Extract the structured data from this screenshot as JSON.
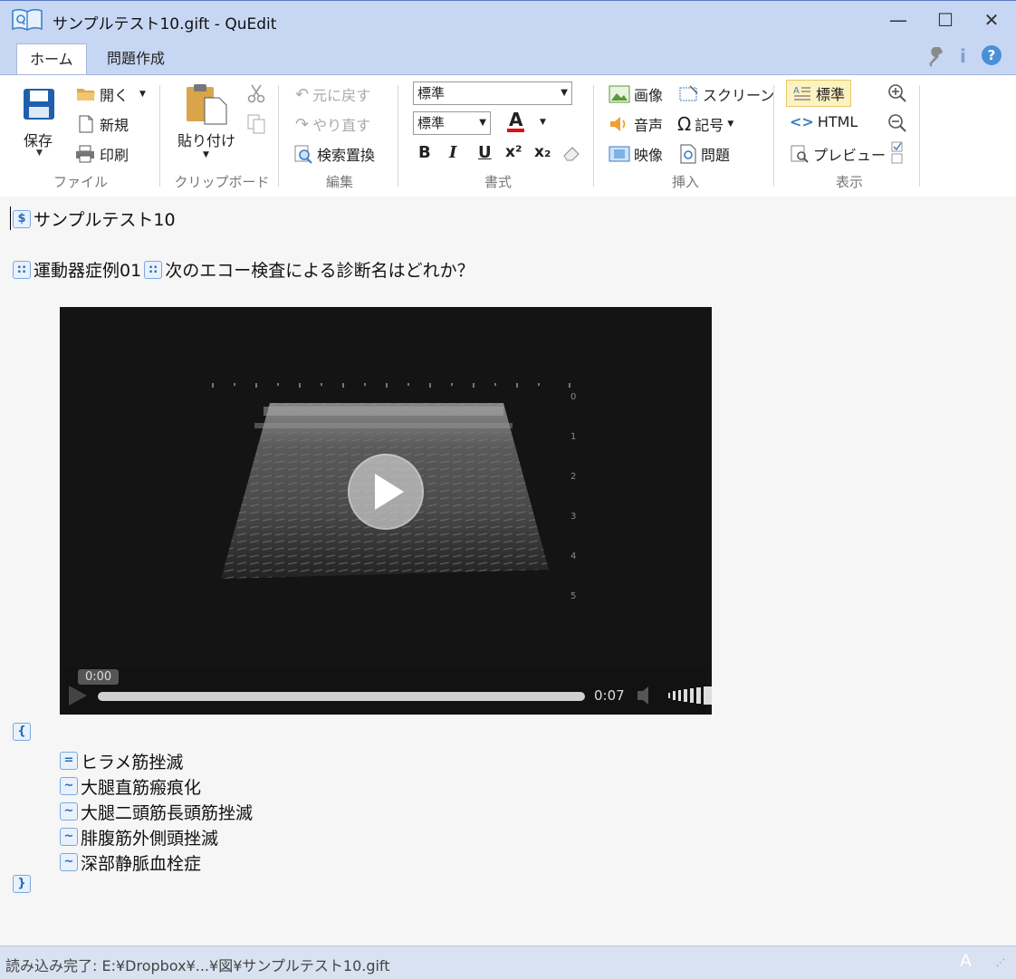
{
  "window": {
    "title": "サンプルテスト10.gift - QuEdit",
    "minimize": "—",
    "maximize": "☐",
    "close": "✕"
  },
  "tabs": {
    "home": "ホーム",
    "create": "問題作成"
  },
  "ribbon": {
    "file": {
      "save": "保存",
      "open": "開く",
      "new": "新規",
      "print": "印刷",
      "label": "ファイル"
    },
    "clipboard": {
      "paste": "貼り付け",
      "label": "クリップボード"
    },
    "edit": {
      "undo": "元に戻す",
      "redo": "やり直す",
      "find_replace": "検索置換",
      "label": "編集"
    },
    "format": {
      "style": "標準",
      "font": "標準",
      "bold": "B",
      "italic": "I",
      "underline": "U",
      "sup": "x²",
      "sub": "x₂",
      "color_letter": "A",
      "label": "書式"
    },
    "insert": {
      "image": "画像",
      "screen": "スクリーン",
      "audio": "音声",
      "symbol": "記号",
      "video": "映像",
      "question": "問題",
      "label": "挿入"
    },
    "view": {
      "standard": "標準",
      "html": "HTML",
      "preview": "プレビュー",
      "label": "表示"
    }
  },
  "editor": {
    "title_tag": "$",
    "title": "サンプルテスト10",
    "q_tag": "::",
    "q_name": "運動器症例01",
    "q_text": "次のエコー検査による診断名はどれか？",
    "open_brace": "{",
    "close_brace": "}",
    "answers": [
      {
        "tag": "=",
        "text": "ヒラメ筋挫滅"
      },
      {
        "tag": "~",
        "text": "大腿直筋瘢痕化"
      },
      {
        "tag": "~",
        "text": "大腿二頭筋長頭筋挫滅"
      },
      {
        "tag": "~",
        "text": "腓腹筋外側頭挫滅"
      },
      {
        "tag": "~",
        "text": "深部静脈血栓症"
      }
    ],
    "video": {
      "current_time": "0:00",
      "duration": "0:07",
      "progress": 0.0,
      "depth_ticks": [
        "0",
        "1",
        "2",
        "3",
        "4",
        "5"
      ]
    }
  },
  "status": {
    "text": "読み込み完了: E:¥Dropbox¥...¥図¥サンプルテスト10.gift",
    "corner": "A"
  },
  "colors": {
    "accent": "#2a6ab8",
    "titlebar": "#c7d7f3"
  }
}
